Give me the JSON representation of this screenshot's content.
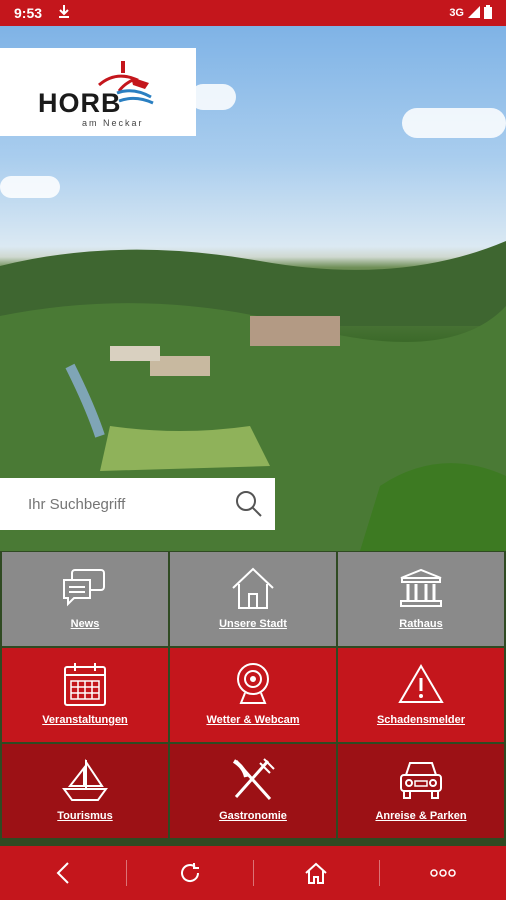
{
  "status": {
    "time": "9:53",
    "network": "3G"
  },
  "logo": {
    "name": "HORB",
    "sub": "am Neckar"
  },
  "search": {
    "placeholder": "Ihr Suchbegriff"
  },
  "tiles": [
    {
      "label": "News",
      "icon": "chat-bubbles-icon",
      "color": "#8a8a8a"
    },
    {
      "label": "Unsere Stadt",
      "icon": "house-icon",
      "color": "#8a8a8a"
    },
    {
      "label": "Rathaus",
      "icon": "town-hall-icon",
      "color": "#8a8a8a"
    },
    {
      "label": "Veranstaltungen",
      "icon": "calendar-icon",
      "color": "#c4161c"
    },
    {
      "label": "Wetter & Webcam",
      "icon": "webcam-icon",
      "color": "#c4161c"
    },
    {
      "label": "Schadensmelder",
      "icon": "warning-icon",
      "color": "#c4161c"
    },
    {
      "label": "Tourismus",
      "icon": "sailboat-icon",
      "color": "#9c1115"
    },
    {
      "label": "Gastronomie",
      "icon": "fork-knife-icon",
      "color": "#9c1115"
    },
    {
      "label": "Anreise & Parken",
      "icon": "car-icon",
      "color": "#9c1115"
    }
  ],
  "bottom_nav": [
    "back-icon",
    "reload-icon",
    "home-icon",
    "more-icon"
  ]
}
